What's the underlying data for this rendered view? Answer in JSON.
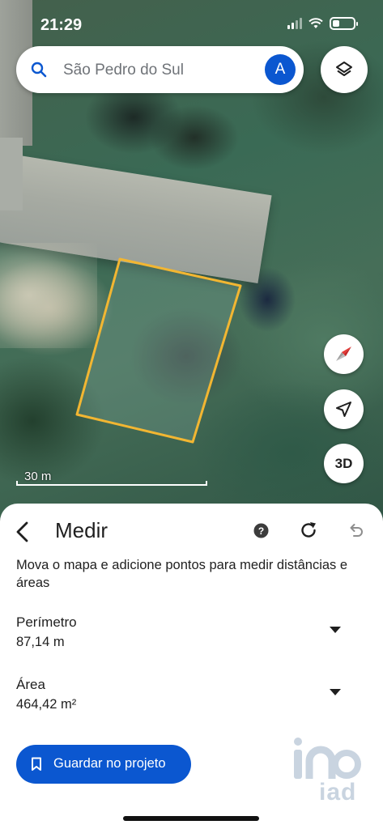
{
  "status_bar": {
    "time": "21:29"
  },
  "search": {
    "text": "São Pedro do Sul",
    "account_initial": "A"
  },
  "map": {
    "scale_label": "30 m",
    "parcel_color": "#f2b632",
    "buttons": {
      "compass": "compass-icon",
      "my_location": "navigation-arrow-icon",
      "three_d": "3D"
    }
  },
  "measure_panel": {
    "title": "Medir",
    "instructions": "Mova o mapa e adicione pontos para medir distâncias e áreas",
    "perimeter": {
      "label": "Perímetro",
      "value": "87,14 m"
    },
    "area": {
      "label": "Área",
      "value": "464,42 m²"
    },
    "save_button": "Guardar no projeto",
    "watermark": "iad"
  },
  "colors": {
    "accent": "#0b57d0",
    "text": "#1f1f1f"
  }
}
